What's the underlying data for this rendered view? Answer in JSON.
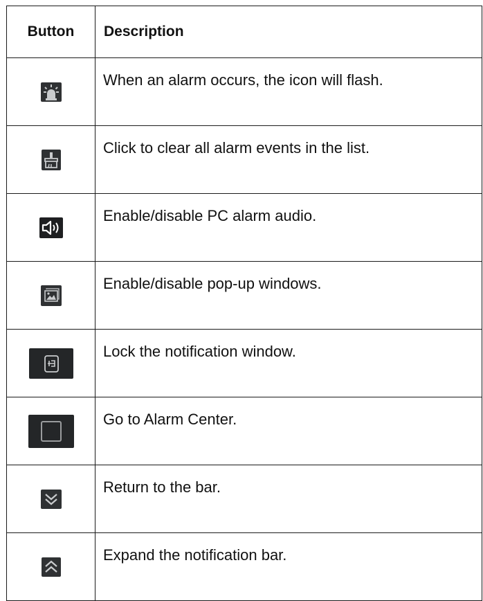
{
  "table": {
    "headers": {
      "button": "Button",
      "description": "Description"
    },
    "rows": [
      {
        "icon": "alarm-light-icon",
        "description": "When an alarm occurs, the icon will flash."
      },
      {
        "icon": "clear-broom-icon",
        "description": "Click to clear all alarm events in the list."
      },
      {
        "icon": "speaker-icon",
        "description": "Enable/disable PC alarm audio."
      },
      {
        "icon": "popup-window-icon",
        "description": "Enable/disable pop-up windows."
      },
      {
        "icon": "lock-pin-icon",
        "description": "Lock the notification window."
      },
      {
        "icon": "alarm-center-icon",
        "description": "Go to Alarm Center."
      },
      {
        "icon": "chevron-double-down-icon",
        "description": "Return to the bar."
      },
      {
        "icon": "chevron-double-up-icon",
        "description": "Expand the notification bar."
      }
    ]
  },
  "colors": {
    "icon_bg": "#2f3133",
    "icon_fg": "#c9cbcd",
    "border": "#1a1a1a"
  }
}
